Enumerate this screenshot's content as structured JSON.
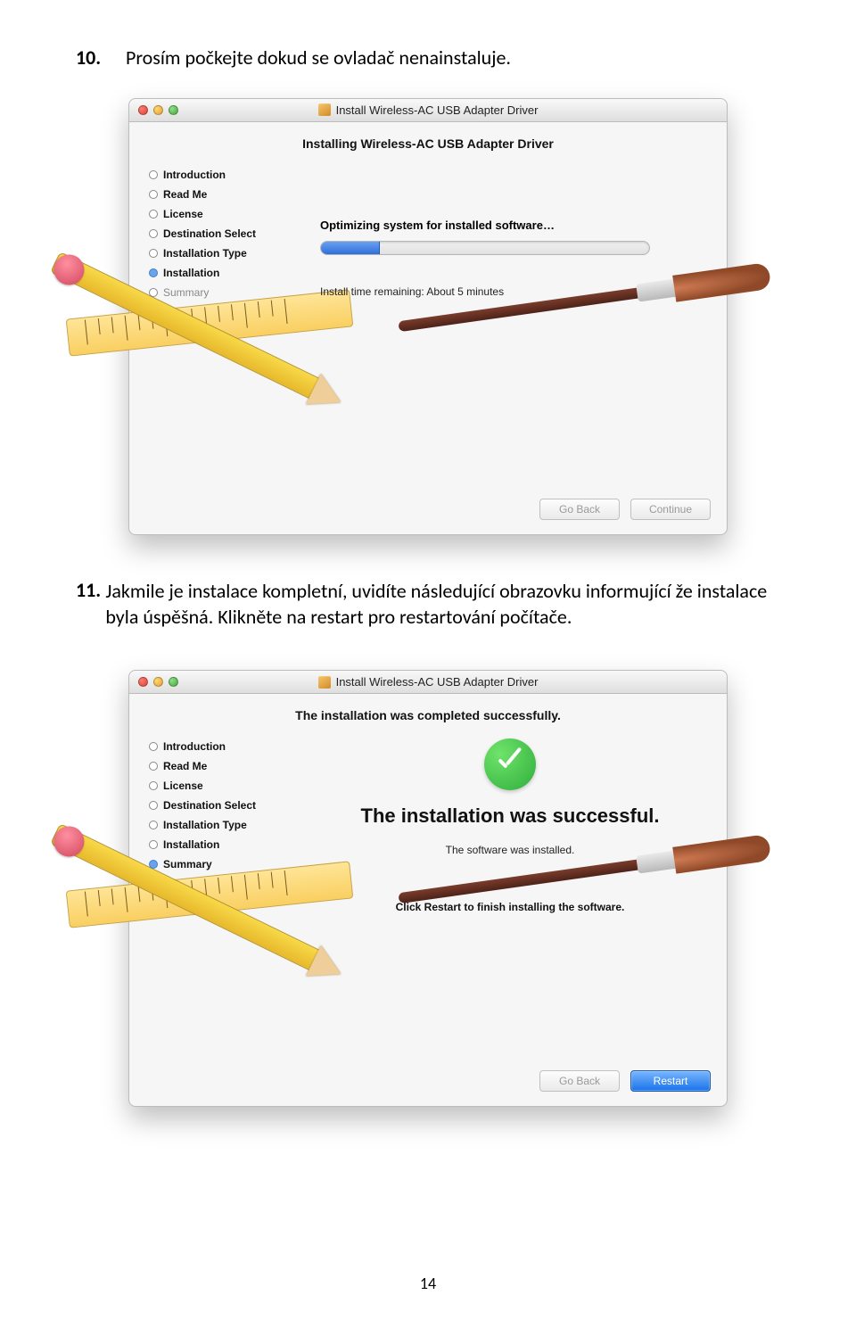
{
  "step10": {
    "num": "10.",
    "text": "Prosím počkejte dokud se ovladač nenainstaluje."
  },
  "step11": {
    "num": "11.",
    "text": "Jakmile je instalace kompletní, uvidíte následující obrazovku informující že instalace byla úspěšná. Klikněte na restart pro restartování počítače."
  },
  "installer": {
    "windowTitle": "Install Wireless-AC USB Adapter Driver",
    "subtitle": "Installing Wireless-AC USB Adapter Driver",
    "sidebar": [
      "Introduction",
      "Read Me",
      "License",
      "Destination Select",
      "Installation Type",
      "Installation",
      "Summary"
    ],
    "progressText": "Optimizing system for installed software…",
    "progressPercent": 18,
    "timeRemaining": "Install time remaining: About 5 minutes",
    "buttons": {
      "goBack": "Go Back",
      "continue": "Continue"
    }
  },
  "installer2": {
    "subtitle": "The installation was completed successfully.",
    "bigSuccess": "The installation was successful.",
    "subSuccess": "The software was installed.",
    "bottomLine": "Click Restart to finish installing the software.",
    "buttons": {
      "goBack": "Go Back",
      "restart": "Restart"
    }
  },
  "pageNumber": "14"
}
